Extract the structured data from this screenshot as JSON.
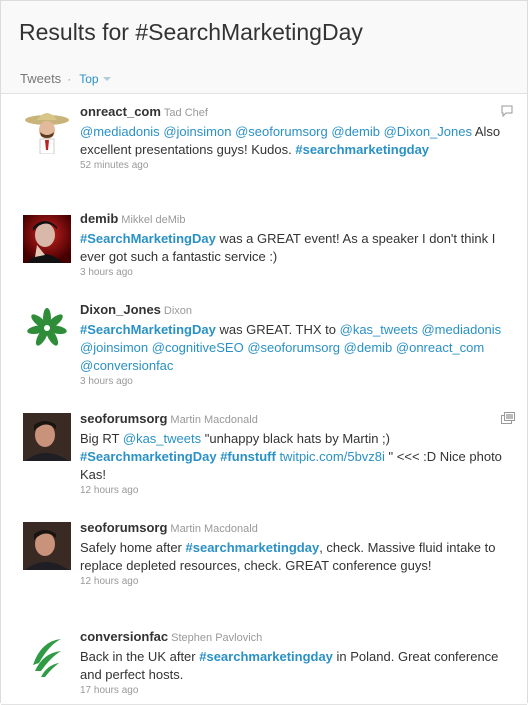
{
  "header": {
    "title": "Results for #SearchMarketingDay",
    "tab_tweets": "Tweets",
    "tab_sep": "·",
    "tab_top": "Top"
  },
  "tweets": [
    {
      "screen_name": "onreact_com",
      "full_name": "Tad Chef",
      "segments": [
        "@mediadonis",
        " ",
        "@joinsimon",
        " ",
        "@seoforumsorg",
        " ",
        "@demib",
        " ",
        "@Dixon_Jones",
        " Also excellent presentations guys! Kudos. ",
        "#searchmarketingday"
      ],
      "time": "52 minutes ago",
      "icon": "reply-icon"
    },
    {
      "screen_name": "demib",
      "full_name": "Mikkel deMib",
      "segments": [
        "#SearchMarketingDay",
        " was a GREAT event! As a speaker I don't think I ever got such a fantastic service :)"
      ],
      "time": "3 hours ago"
    },
    {
      "screen_name": "Dixon_Jones",
      "full_name": "Dixon",
      "segments": [
        "#SearchMarketingDay",
        " was GREAT. THX to ",
        "@kas_tweets",
        " ",
        "@mediadonis",
        " ",
        "@joinsimon",
        " ",
        "@cognitiveSEO",
        " ",
        "@seoforumsorg",
        " ",
        "@demib",
        " ",
        "@onreact_com",
        " ",
        "@conversionfac"
      ],
      "time": "3 hours ago"
    },
    {
      "screen_name": "seoforumsorg",
      "full_name": "Martin Macdonald",
      "segments": [
        "Big RT ",
        "@kas_tweets",
        " \"unhappy black hats by Martin ;) ",
        "#SearchmarketingDay",
        " ",
        "#funstuff",
        " ",
        "twitpic.com/5bvz8i",
        " \" <<< :D Nice photo Kas!"
      ],
      "time": "12 hours ago",
      "icon": "media-icon"
    },
    {
      "screen_name": "seoforumsorg",
      "full_name": "Martin Macdonald",
      "segments": [
        "Safely home after ",
        "#searchmarketingday",
        ", check. Massive fluid intake to replace depleted resources, check. GREAT conference guys!"
      ],
      "time": "12 hours ago"
    },
    {
      "screen_name": "conversionfac",
      "full_name": "Stephen Pavlovich",
      "segments": [
        "Back in the UK after ",
        "#searchmarketingday",
        " in Poland. Great conference and perfect hosts."
      ],
      "time": "17 hours ago"
    }
  ],
  "colors": {
    "link": "#2a91c6",
    "text": "#333333",
    "meta": "#999999"
  }
}
